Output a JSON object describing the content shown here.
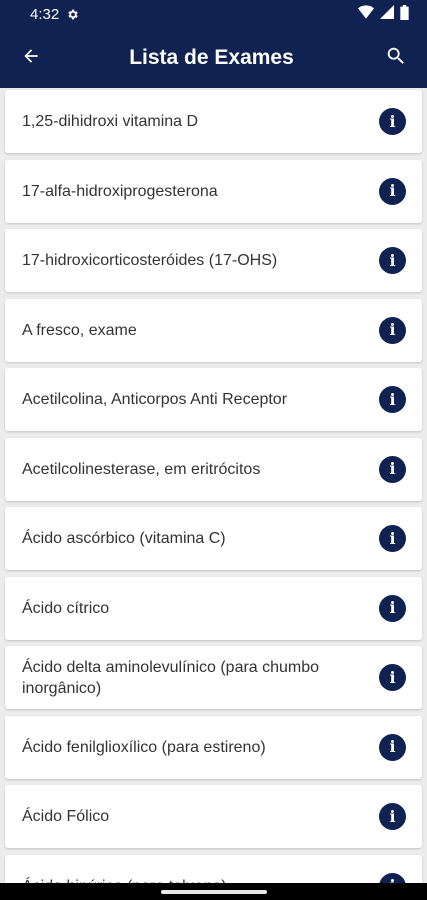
{
  "status_bar": {
    "time": "4:32",
    "icons": [
      "settings-icon",
      "wifi-icon",
      "signal-icon",
      "battery-icon"
    ]
  },
  "app_bar": {
    "title": "Lista de Exames",
    "back_icon": "arrow-left-icon",
    "search_icon": "search-icon"
  },
  "colors": {
    "primary": "#0f2252",
    "background": "#ececec",
    "card": "#ffffff",
    "text": "#333333"
  },
  "exams": [
    "1,25-dihidroxi vitamina D",
    "17-alfa-hidroxiprogesterona",
    "17-hidroxicorticosteróides (17-OHS)",
    "A fresco, exame",
    "Acetilcolina, Anticorpos Anti Receptor",
    "Acetilcolinesterase, em eritrócitos",
    "Ácido ascórbico (vitamina C)",
    "Ácido cítrico",
    "Ácido delta aminolevulínico (para chumbo inorgânico)",
    "Ácido fenilglioxílico (para estireno)",
    "Ácido Fólico",
    "Ácido hipúrico (para tolueno)"
  ],
  "info_icon": "info-icon"
}
